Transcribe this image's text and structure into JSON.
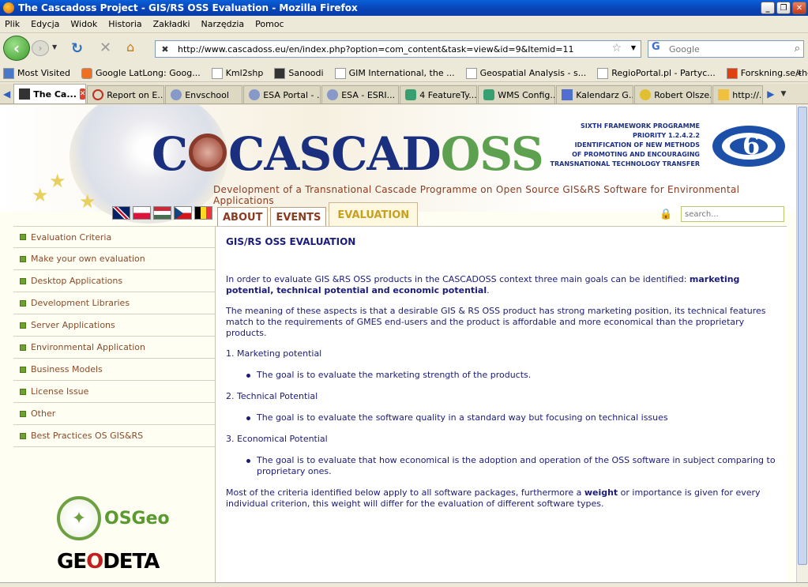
{
  "window": {
    "title": "The Cascadoss Project - GIS/RS OSS Evaluation - Mozilla Firefox"
  },
  "menu": [
    "Plik",
    "Edycja",
    "Widok",
    "Historia",
    "Zakładki",
    "Narzędzia",
    "Pomoc"
  ],
  "nav": {
    "url": "http://www.cascadoss.eu/en/index.php?option=com_content&task=view&id=9&Itemid=11",
    "search_placeholder": "Google"
  },
  "bookmarks": [
    "Most Visited",
    "Google LatLong: Goog...",
    "Kml2shp",
    "Sanoodi",
    "GIM International, the ...",
    "Geospatial Analysis - s...",
    "RegioPortal.pl - Partyc...",
    "Forskning.se/theplanet"
  ],
  "tabs": [
    "The Ca...",
    "Report on E...",
    "Envschool",
    "ESA Portal - ...",
    "ESA - ESRI...",
    "4 FeatureTy...",
    "WMS Config...",
    "Kalendarz G...",
    "Robert Olsze...",
    "http://...r"
  ],
  "site": {
    "logo_main": "CASCAD",
    "logo_oss": "OSS",
    "tagline": "Development of a Transnational Cascade Programme on Open Source GIS&RS Software for Environmental Applications",
    "eu_lines": [
      "SIXTH FRAMEWORK PROGRAMME",
      "PRIORITY 1.2.4.2.2",
      "IDENTIFICATION OF NEW METHODS",
      "OF PROMOTING AND ENCOURAGING",
      "TRANSNATIONAL TECHNOLOGY TRANSFER"
    ],
    "nav_tabs": [
      "ABOUT",
      "EVENTS",
      "EVALUATION"
    ],
    "search_placeholder": "search..."
  },
  "leftnav": [
    "Evaluation Criteria",
    "Make your own evaluation",
    "Desktop Applications",
    "Development Libraries",
    "Server Applications",
    "Environmental Application",
    "Business Models",
    "License Issue",
    "Other",
    "Best Practices OS GIS&RS"
  ],
  "logos": {
    "osgeo": "OSGeo",
    "geodeta_pre": "GE",
    "geodeta_o": "O",
    "geodeta_post": "DETA"
  },
  "article": {
    "title": "GIS/RS OSS EVALUATION",
    "intro_pre": "In order to evaluate GIS &RS OSS products in the CASCADOSS context three main goals can be identified: ",
    "intro_bold": "marketing potential, technical potential and economic potential",
    "intro_post": ".",
    "meaning": "The meaning of these aspects is that a desirable GIS & RS OSS product has strong marketing position, its technical features match to the requirements of GMES end-users and the product is affordable and more economical than the proprietary products.",
    "items": [
      {
        "head": "1. Marketing potential",
        "bullet": "The goal is to evaluate the marketing strength of the products."
      },
      {
        "head": "2. Technical Potential",
        "bullet": "The goal is to evaluate the software quality in a standard way but focusing on technical issues"
      },
      {
        "head": "3. Economical Potential",
        "bullet": "The goal is to evaluate that how economical is the adoption and operation of the OSS software in subject comparing to proprietary ones."
      }
    ],
    "closing_pre": " Most of the criteria identified below apply to all software packages, furthermore a ",
    "closing_bold": "weight",
    "closing_post": " or importance is given for every individual criterion, this weight will differ for the evaluation of different software types."
  }
}
